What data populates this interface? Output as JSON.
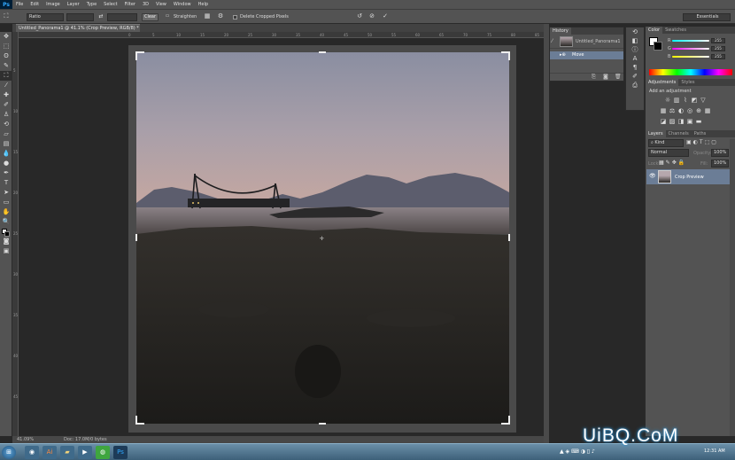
{
  "app": {
    "logo": "Ps",
    "menu": [
      "File",
      "Edit",
      "Image",
      "Layer",
      "Type",
      "Select",
      "Filter",
      "3D",
      "View",
      "Window",
      "Help"
    ]
  },
  "options": {
    "preset": "Ratio",
    "clear": "Clear",
    "straighten": "Straighten",
    "delete_cropped": "Delete Cropped Pixels",
    "workspace": "Essentials"
  },
  "document": {
    "tab_title": "Untitled_Panorama1 @ 41.1% (Crop Preview, RGB/8) *",
    "zoom": "41.09%",
    "doc_info": "Doc: 17.0M/0 bytes",
    "ruler_ticks": [
      "0",
      "5",
      "10",
      "15",
      "20",
      "25",
      "30",
      "35",
      "40",
      "45",
      "50",
      "55",
      "60",
      "65",
      "70",
      "75",
      "80",
      "85",
      "90"
    ],
    "ruler_left_ticks": [
      "5",
      "10",
      "15",
      "20",
      "25",
      "30",
      "35",
      "40",
      "45"
    ]
  },
  "history": {
    "tab": "History",
    "snapshot": "Untitled_Panorama1",
    "step": "Move"
  },
  "color": {
    "tabs": [
      "Color",
      "Swatches"
    ],
    "labels": [
      "R",
      "G",
      "B"
    ],
    "values": [
      "255",
      "255",
      "255"
    ]
  },
  "adjustments": {
    "tabs": [
      "Adjustments",
      "Styles"
    ],
    "hint": "Add an adjustment"
  },
  "layers": {
    "tabs": [
      "Layers",
      "Channels",
      "Paths"
    ],
    "kind": "Kind",
    "blend": "Normal",
    "opacity_label": "Opacity:",
    "opacity": "100%",
    "lock_label": "Lock:",
    "fill_label": "Fill:",
    "fill": "100%",
    "layer_name": "Crop Preview"
  },
  "taskbar": {
    "time": "12:31 AM"
  },
  "watermark": "UiBQ.CoM",
  "colors": {
    "ps_blue": "#31a8ff",
    "selection": "#6b7d96",
    "panel": "#535353"
  }
}
